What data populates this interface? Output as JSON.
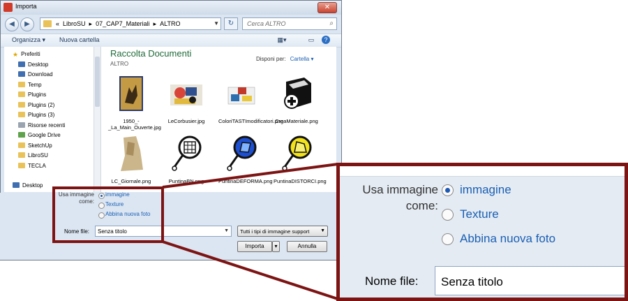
{
  "window": {
    "title": "Importa",
    "close_glyph": "✕"
  },
  "address": {
    "back_glyph": "◀",
    "forward_glyph": "▶",
    "breadcrumbs": [
      "«",
      "LibroSU",
      "▸",
      "07_CAP7_Materiali",
      "▸",
      "ALTRO"
    ],
    "refresh_glyph": "↻",
    "search_placeholder": "Cerca ALTRO",
    "search_icon": "search-icon"
  },
  "toolbar": {
    "organize": "Organizza ▾",
    "new_folder": "Nuova cartella"
  },
  "sidebar": {
    "items": [
      {
        "label": "Preferiti",
        "icon": "star-icon"
      },
      {
        "label": "Desktop",
        "icon": "desktop-icon"
      },
      {
        "label": "Download",
        "icon": "download-folder-icon"
      },
      {
        "label": "Temp",
        "icon": "folder-icon"
      },
      {
        "label": "Plugins",
        "icon": "folder-icon"
      },
      {
        "label": "Plugins (2)",
        "icon": "folder-icon"
      },
      {
        "label": "Plugins (3)",
        "icon": "folder-icon"
      },
      {
        "label": "Risorse recenti",
        "icon": "recent-icon"
      },
      {
        "label": "Google Drive",
        "icon": "drive-icon"
      },
      {
        "label": "SketchUp",
        "icon": "folder-icon"
      },
      {
        "label": "LibroSU",
        "icon": "folder-icon"
      },
      {
        "label": "TECLA",
        "icon": "folder-icon"
      },
      {
        "label": "Desktop",
        "icon": "desktop-icon"
      }
    ]
  },
  "library": {
    "title": "Raccolta Documenti",
    "subtitle": "ALTRO",
    "arrange_label": "Disponi per:",
    "arrange_value": "Cartella ▾"
  },
  "files": [
    {
      "name": "1950_-_La_Main_Ouverte.jpg"
    },
    {
      "name": "LeCorbusier.jpg"
    },
    {
      "name": "ColoriTASTImodificatori.png"
    },
    {
      "name": "CreaMateriale.png"
    },
    {
      "name": "LC_Giornale.png"
    },
    {
      "name": "PuntinaBN.png"
    },
    {
      "name": "PuntinaDEFORMA.png"
    },
    {
      "name": "PuntinaDISTORCI.png"
    }
  ],
  "options": {
    "use_image_as": "Usa immagine come:",
    "choices": [
      "immagine",
      "Texture",
      "Abbina nuova foto"
    ],
    "selected": "immagine"
  },
  "filename": {
    "label": "Nome file:",
    "value": "Senza titolo"
  },
  "filetype": {
    "value": "Tutti i tipi di immagine support"
  },
  "buttons": {
    "import": "Importa",
    "cancel": "Annulla"
  },
  "zoom": {
    "use_image_as": "Usa immagine come:",
    "choices": [
      "immagine",
      "Texture",
      "Abbina nuova foto"
    ],
    "filename_label": "Nome file:",
    "filename_value": "Senza titolo"
  }
}
